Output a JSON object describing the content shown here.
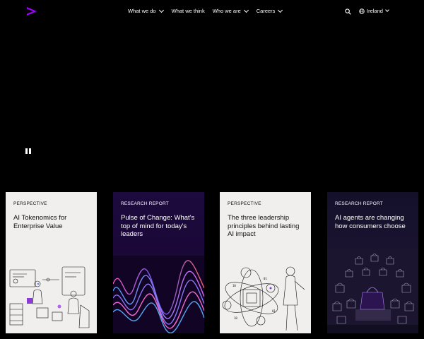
{
  "header": {
    "logo": "accenture-greater-than-logo",
    "nav": [
      {
        "label": "What we do",
        "has_dropdown": true
      },
      {
        "label": "What we think",
        "has_dropdown": false
      },
      {
        "label": "Who we are",
        "has_dropdown": true
      },
      {
        "label": "Careers",
        "has_dropdown": true
      }
    ],
    "search_icon": "search-icon",
    "region": {
      "icon": "globe-icon",
      "label": "Ireland"
    }
  },
  "hero": {
    "pause_icon": "pause-icon"
  },
  "cards": [
    {
      "tag": "PERSPECTIVE",
      "title": "AI Tokenomics for Enterprise Value",
      "theme": "light"
    },
    {
      "tag": "RESEARCH REPORT",
      "title": "Pulse of Change: What's top of mind for today's leaders",
      "theme": "dark"
    },
    {
      "tag": "PERSPECTIVE",
      "title": "The three leadership principles behind lasting AI impact",
      "theme": "light"
    },
    {
      "tag": "RESEARCH REPORT",
      "title": "AI agents are changing how consumers choose",
      "theme": "dark"
    }
  ],
  "colors": {
    "brand_accent": "#a100ff",
    "background": "#000000",
    "light_card": "#f0efed",
    "dark_card": "#1a0836"
  }
}
